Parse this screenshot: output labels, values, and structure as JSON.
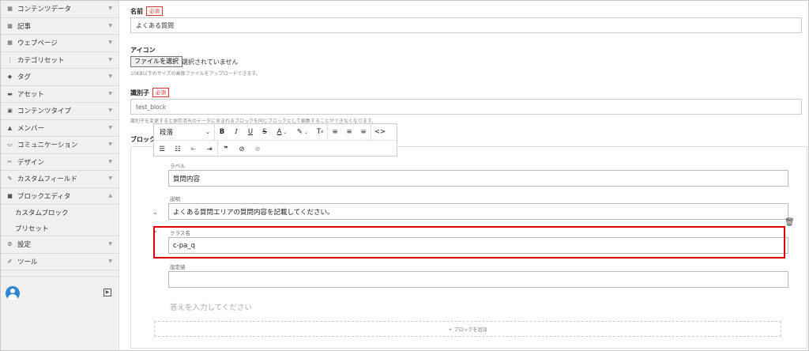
{
  "sidebar": {
    "items": [
      {
        "icon": "grid-icon",
        "glyph": "▦",
        "label": "コンテンツデータ",
        "chev": "▼"
      },
      {
        "icon": "grid-icon",
        "glyph": "▦",
        "label": "記事",
        "chev": "▼"
      },
      {
        "icon": "grid-icon",
        "glyph": "▦",
        "label": "ウェブページ",
        "chev": "▼"
      },
      {
        "icon": "category-icon",
        "glyph": "⋮",
        "label": "カテゴリセット",
        "chev": "▼"
      },
      {
        "icon": "tag-icon",
        "glyph": "◆",
        "label": "タグ",
        "chev": "▼"
      },
      {
        "icon": "briefcase-icon",
        "glyph": "▬",
        "label": "アセット",
        "chev": "▼"
      },
      {
        "icon": "grid-icon",
        "glyph": "▣",
        "label": "コンテンツタイプ",
        "chev": "▼"
      },
      {
        "icon": "user-icon",
        "glyph": "▲",
        "label": "メンバー",
        "chev": "▼"
      },
      {
        "icon": "comment-icon",
        "glyph": "▭",
        "label": "コミュニケーション",
        "chev": "▼"
      },
      {
        "icon": "design-icon",
        "glyph": "✂",
        "label": "デザイン",
        "chev": "▼"
      },
      {
        "icon": "field-icon",
        "glyph": "✎",
        "label": "カスタムフィールド",
        "chev": "▼"
      },
      {
        "icon": "block-editor-icon",
        "glyph": "■",
        "label": "ブロックエディタ",
        "chev": "▲"
      }
    ],
    "subitems": [
      "カスタムブロック",
      "プリセット"
    ],
    "items2": [
      {
        "icon": "gear-icon",
        "glyph": "⚙",
        "label": "設定",
        "chev": "▼"
      },
      {
        "icon": "wrench-icon",
        "glyph": "✐",
        "label": "ツール",
        "chev": "▼"
      }
    ]
  },
  "form": {
    "name_label": "名前",
    "required": "必須",
    "name_value": "よくある質問",
    "icon_label": "アイコン",
    "file_button": "ファイルを選択",
    "file_status": "選択されていません",
    "icon_help": "10KB以下のサイズの画像ファイルをアップロードできます。",
    "identifier_label": "識別子",
    "identifier_value": "test_block",
    "identifier_help": "識別子を変更すると保存済みのデータに含まれるブロックを同じブロックとして編集することができなくなります。",
    "block_label": "ブロック"
  },
  "toolbar": {
    "paragraph": "段落"
  },
  "block": {
    "label_caption": "ラベル",
    "label_value": "質問内容",
    "desc_caption": "説明",
    "desc_value": "よくある質問エリアの質問内容を記載してください。",
    "class_caption": "クラス名",
    "class_value": "c-pa_q",
    "setting_caption": "設定値",
    "setting_value": "",
    "answer_placeholder": "答えを入力してください",
    "add_block": "+ ブロックを追加"
  }
}
